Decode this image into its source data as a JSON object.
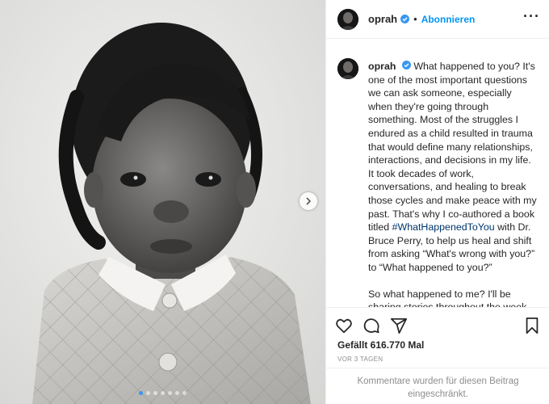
{
  "post": {
    "username": "oprah",
    "separator": "•",
    "follow_label": "Abonnieren",
    "more_label": "···",
    "caption": {
      "username": "oprah",
      "before_hashtag": "What happened to you? It's one of the most important questions we can ask someone, especially when they're going through something. Most of the struggles I endured as a child resulted in trauma that would define many relationships, interactions, and decisions in my life. It took decades of work, conversations, and healing to break those cycles and make peace with my past. That's why I co-authored a book titled ",
      "hashtag": "#WhatHappenedToYou",
      "after_hashtag": " with Dr. Bruce Perry, to help us heal and shift from asking “What's wrong with you?” to “What happened to you?”",
      "paragraph2": "So what happened to me? I'll be sharing stories throughout the week from my own life and I hope you share"
    },
    "likes": "Gefällt 616.770 Mal",
    "time": "VOR 3 TAGEN",
    "comments_disabled": "Kommentare wurden für diesen Beitrag eingeschränkt."
  },
  "carousel": {
    "dot_count": 7,
    "active_index": 0
  },
  "colors": {
    "accent": "#0095f6",
    "verified": "#3897f0",
    "hashtag": "#00376b",
    "muted": "#8e8e8e"
  },
  "icons": [
    "verified-badge-icon",
    "more-options-icon",
    "heart-icon",
    "comment-icon",
    "share-icon",
    "bookmark-icon",
    "chevron-right-icon"
  ]
}
